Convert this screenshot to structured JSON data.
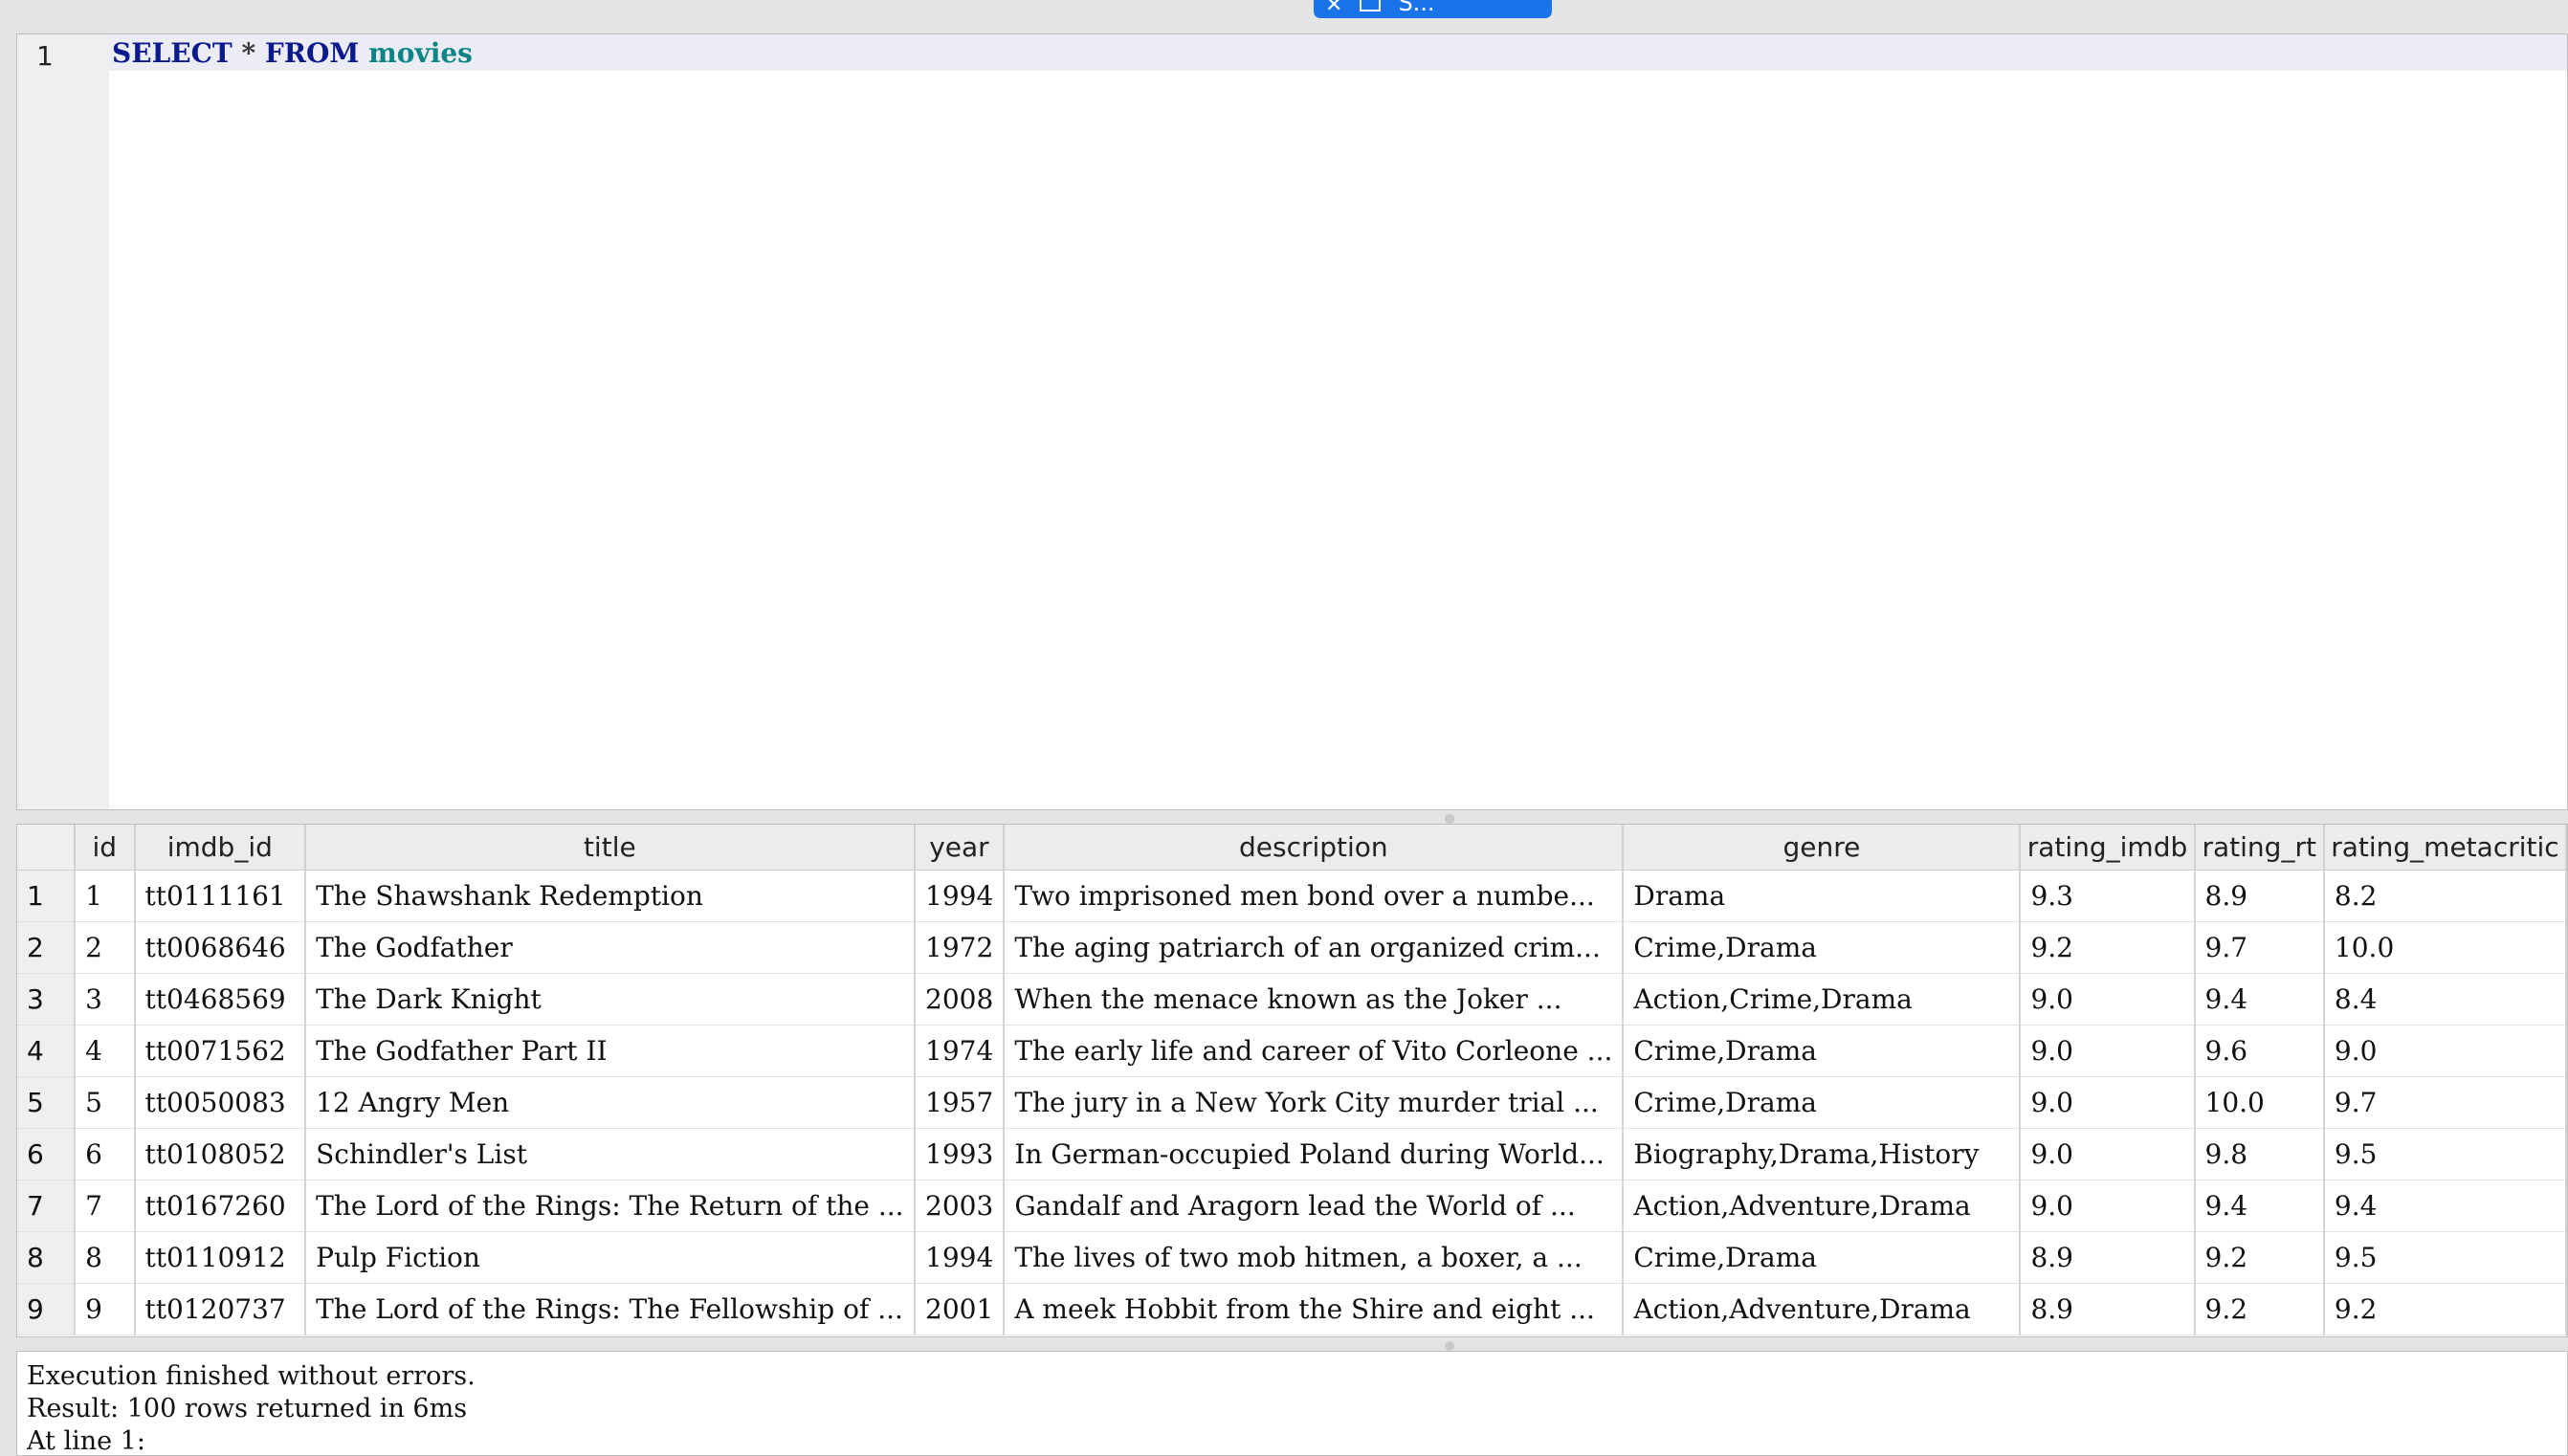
{
  "top_tab": {
    "label": "S...",
    "close_icon": "close-icon",
    "doc_icon": "document-icon"
  },
  "editor": {
    "line_number": "1",
    "code": [
      {
        "text": "SELECT",
        "kind": "keyword"
      },
      {
        "text": " * ",
        "kind": "operator"
      },
      {
        "text": "FROM",
        "kind": "keyword"
      },
      {
        "text": " movies",
        "kind": "identifier"
      }
    ]
  },
  "results": {
    "columns": [
      "id",
      "imdb_id",
      "title",
      "year",
      "description",
      "genre",
      "rating_imdb",
      "rating_rt",
      "rating_metacritic"
    ],
    "rows": [
      [
        "1",
        "1",
        "tt0111161",
        "The Shawshank Redemption",
        "1994",
        "Two imprisoned men bond over a numbe...",
        "Drama",
        "9.3",
        "8.9",
        "8.2"
      ],
      [
        "2",
        "2",
        "tt0068646",
        "The Godfather",
        "1972",
        "The aging patriarch of an organized crim...",
        "Crime,Drama",
        "9.2",
        "9.7",
        "10.0"
      ],
      [
        "3",
        "3",
        "tt0468569",
        "The Dark Knight",
        "2008",
        "When the menace known as the Joker ...",
        "Action,Crime,Drama",
        "9.0",
        "9.4",
        "8.4"
      ],
      [
        "4",
        "4",
        "tt0071562",
        "The Godfather Part II",
        "1974",
        "The early life and career of Vito Corleone ...",
        "Crime,Drama",
        "9.0",
        "9.6",
        "9.0"
      ],
      [
        "5",
        "5",
        "tt0050083",
        "12 Angry Men",
        "1957",
        "The jury in a New York City murder trial ...",
        "Crime,Drama",
        "9.0",
        "10.0",
        "9.7"
      ],
      [
        "6",
        "6",
        "tt0108052",
        "Schindler's List",
        "1993",
        "In German-occupied Poland during World...",
        "Biography,Drama,History",
        "9.0",
        "9.8",
        "9.5"
      ],
      [
        "7",
        "7",
        "tt0167260",
        "The Lord of the Rings: The Return of the ...",
        "2003",
        "Gandalf and Aragorn lead the World of ...",
        "Action,Adventure,Drama",
        "9.0",
        "9.4",
        "9.4"
      ],
      [
        "8",
        "8",
        "tt0110912",
        "Pulp Fiction",
        "1994",
        "The lives of two mob hitmen, a boxer, a ...",
        "Crime,Drama",
        "8.9",
        "9.2",
        "9.5"
      ],
      [
        "9",
        "9",
        "tt0120737",
        "The Lord of the Rings: The Fellowship of ...",
        "2001",
        "A meek Hobbit from the Shire and eight ...",
        "Action,Adventure,Drama",
        "8.9",
        "9.2",
        "9.2"
      ]
    ]
  },
  "messages": {
    "line1": "Execution finished without errors.",
    "line2": "Result: 100 rows returned in 6ms",
    "line3": "At line 1:"
  }
}
